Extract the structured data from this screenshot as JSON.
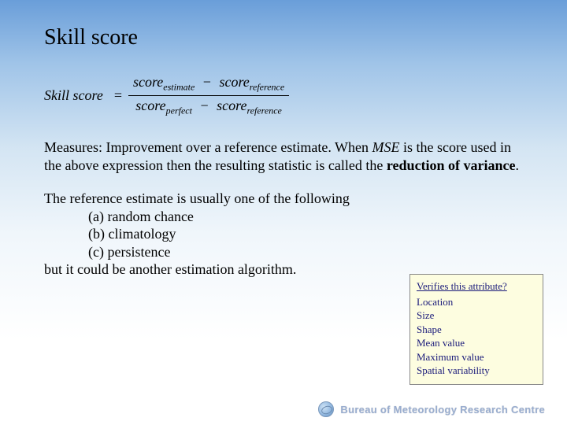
{
  "title": "Skill score",
  "formula": {
    "lhs": "Skill score",
    "num_left": "score",
    "num_left_sub": "estimate",
    "num_right": "score",
    "num_right_sub": "reference",
    "den_left": "score",
    "den_left_sub": "perfect",
    "den_right": "score",
    "den_right_sub": "reference"
  },
  "p1": {
    "lead": "Measures:",
    "text1": " Improvement over a reference estimate. When ",
    "mse": "MSE",
    "text2": " is the score used in the above expression then the resulting statistic is called the ",
    "rov": "reduction of variance",
    "period": "."
  },
  "p2": {
    "intro": "The reference estimate is usually one of the following",
    "a": "(a) random chance",
    "b": "(b) climatology",
    "c": "(c) persistence",
    "outro": "but it could be another estimation algorithm."
  },
  "callout": {
    "hdr": "Verifies this attribute?",
    "items": [
      "Location",
      "Size",
      "Shape",
      "Mean value",
      "Maximum value",
      "Spatial variability"
    ]
  },
  "footer": "Bureau of Meteorology Research Centre"
}
